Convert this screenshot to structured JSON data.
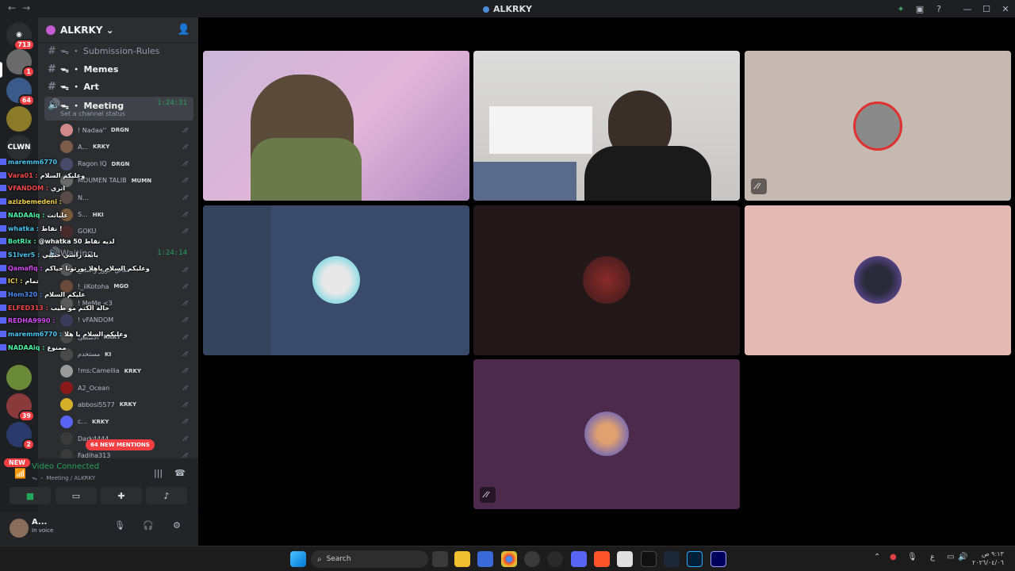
{
  "window": {
    "title": "ALKRKY",
    "nav_back": "←",
    "nav_forward": "→"
  },
  "guild_badges": {
    "g1": "713",
    "g2": "1",
    "g3": "64",
    "g4": "39",
    "g5": "2"
  },
  "guild_texts": {
    "clown": "CLWN"
  },
  "new_badge": "NEW",
  "server": {
    "name": "ALKRKY ⌄"
  },
  "channels": [
    {
      "name": "ᯓ ・ Submission-Rules"
    },
    {
      "name": "ᯓ ・ Memes"
    },
    {
      "name": "ᯓ ・ Art"
    }
  ],
  "meeting": {
    "name": "ᯓ ・ Meeting",
    "time": "1:24:31",
    "status": "Set a channel status"
  },
  "voice_users": [
    {
      "name": "! Nadaa''",
      "tag": "DRGN",
      "color": "#d08a8a"
    },
    {
      "name": "A...",
      "tag": "KRKY",
      "color": "#7d5c4a"
    },
    {
      "name": "Ragon IQ",
      "tag": "DRGN",
      "color": "#4a4a6a"
    },
    {
      "name": "MOUMEN TALIB",
      "tag": "MUMN",
      "color": "#6a6a6a"
    },
    {
      "name": "N...",
      "tag": "",
      "color": "#5a4a4a"
    },
    {
      "name": "S...",
      "tag": "HKI",
      "color": "#7a5a3a"
    },
    {
      "name": "GOKU",
      "tag": "",
      "color": "#4a2a2a"
    }
  ],
  "waiting": {
    "name": "Waiting",
    "time": "1:24:14"
  },
  "waiting_users": [
    {
      "name": "تعالي حزوز واستمع",
      "tag": "",
      "color": "#5a5a5a"
    },
    {
      "name": "!_iiKotoha",
      "tag": "MGO",
      "color": "#6a4a3a"
    },
    {
      "name": "! MeMe <3",
      "tag": "",
      "color": "#5a5a5a"
    },
    {
      "name": "! vFANDOM",
      "tag": "",
      "color": "#3a3a5a"
    },
    {
      "name": "الاسطى",
      "tag": "KRKY",
      "color": "#4a4a4a"
    },
    {
      "name": "مستخدم",
      "tag": "KI",
      "color": "#4a4a4a"
    },
    {
      "name": "!ms:Camellia",
      "tag": "KRKY",
      "color": "#9a9a9a"
    },
    {
      "name": "A2_Ocean",
      "tag": "",
      "color": "#8a1a1a"
    },
    {
      "name": "abbosi5577",
      "tag": "KRKY",
      "color": "#d4b02a"
    },
    {
      "name": "c...",
      "tag": "KRKY",
      "color": "#5865f2"
    },
    {
      "name": "Dark4444",
      "tag": "",
      "color": "#3a3a3a"
    },
    {
      "name": "Fadiha313",
      "tag": "",
      "color": "#3a3a3a"
    }
  ],
  "overlay_chat": [
    {
      "user": "maremm6770",
      "msg": "",
      "color": "#4ac4f2"
    },
    {
      "user": "Vara01 :",
      "msg": "وعليكم السلام",
      "color": "#f24a4a"
    },
    {
      "user": "VFANDOM :",
      "msg": "اتري",
      "color": "#f24a4a"
    },
    {
      "user": "azizbemedeni :",
      "msg": "",
      "color": "#f2d24a"
    },
    {
      "user": "NADAAiq :",
      "msg": "علياتت",
      "color": "#4af2a2"
    },
    {
      "user": "whatka :",
      "msg": "نقاط !",
      "color": "#4ac4f2"
    },
    {
      "user": "BotRix :",
      "msg": "@whatka لديه نقاط 50",
      "color": "#4af2a2"
    },
    {
      "user": "S1lver5 :",
      "msg": "يابعد راسي حبيبي",
      "color": "#4ac4f2"
    },
    {
      "user": "Qamaflq :",
      "msg": "وعليكم السلام ياهلا نورتونا حياكم",
      "color": "#d24af2"
    },
    {
      "user": "IC! :",
      "msg": "تمام",
      "color": "#f2d24a"
    },
    {
      "user": "Hom320 :",
      "msg": "عليكم السلام",
      "color": "#4a8af2"
    },
    {
      "user": "ELFED313 :",
      "msg": "خالة الكتم مو طيب",
      "color": "#f24a4a"
    },
    {
      "user": "REDHA9990 :",
      "msg": "",
      "color": "#d24af2"
    },
    {
      "user": "maremm6770 :",
      "msg": "وعليكم السلام يا هلا",
      "color": "#4ac4f2"
    },
    {
      "user": "NADAAiq :",
      "msg": "ممنوع",
      "color": "#4af2a2"
    }
  ],
  "mentions": "64 NEW MENTIONS",
  "voice": {
    "status": "Video Connected",
    "location": "ᯓ ・ Meeting / ALKRKY"
  },
  "user": {
    "name": "A...",
    "status": "In voice"
  },
  "taskbar": {
    "search": "Search",
    "time": "٩:١٣ ص",
    "date": "٢٠٢٦/٠٤/٠٦",
    "lang": "ع"
  }
}
